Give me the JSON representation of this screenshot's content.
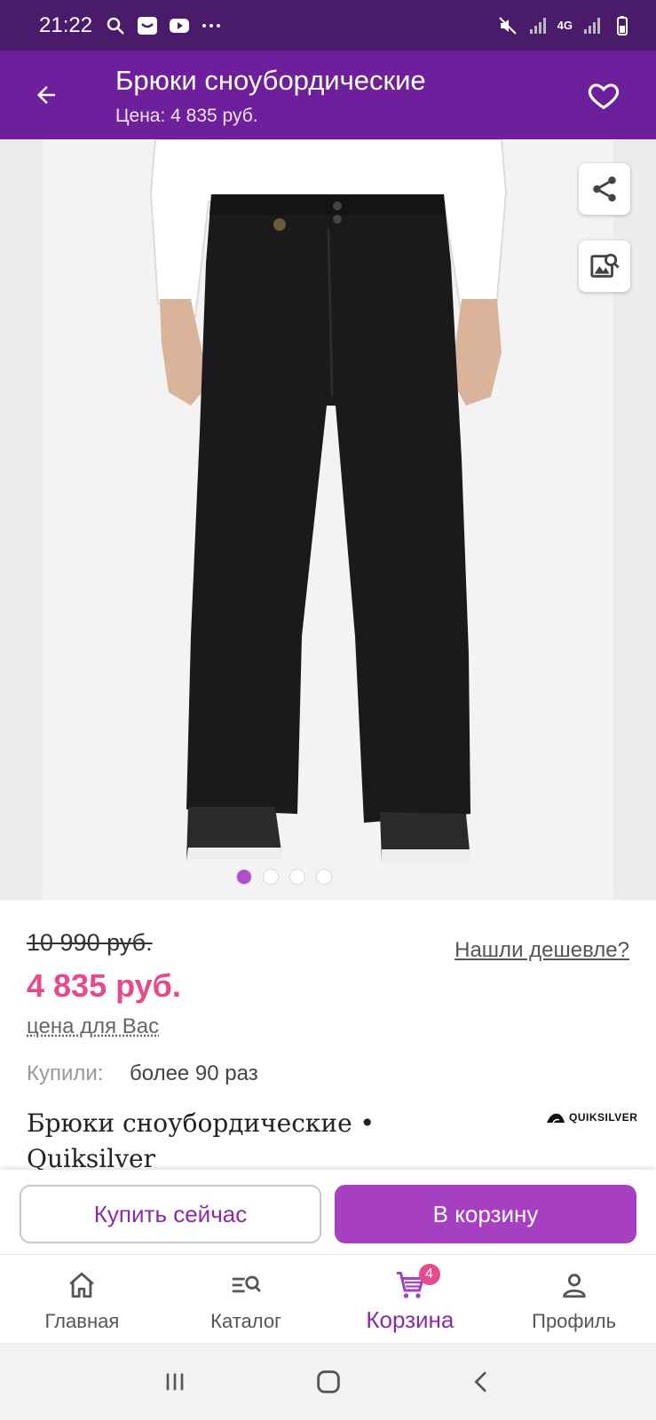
{
  "status_bar": {
    "time": "21:22",
    "icons_left": [
      "search-icon",
      "app-notification-icon",
      "youtube-icon",
      "more-dots-icon"
    ],
    "icons_right": [
      "mute-icon",
      "signal-icon",
      "network-4g-icon",
      "signal-icon",
      "battery-icon"
    ],
    "network_label": "4G"
  },
  "app_bar": {
    "title": "Брюки сноубордические",
    "subtitle": "Цена: 4 835 руб.",
    "background": "#6d1f9c"
  },
  "gallery": {
    "image_count": 4,
    "active_index": 0,
    "buttons": [
      "share-icon",
      "image-search-icon"
    ]
  },
  "product": {
    "old_price": "10 990 руб.",
    "cheaper_link": "Нашли дешевле?",
    "price": "4 835 руб.",
    "price_note": "цена для Вас",
    "bought_label": "Купили:",
    "bought_value": "более 90 раз",
    "name": "Брюки сноубордические • Quiksilver",
    "brand": "QUIKSILVER",
    "price_color": "#e54a8c"
  },
  "actions": {
    "buy_now": "Купить сейчас",
    "to_cart": "В корзину",
    "accent": "#a73fc3"
  },
  "bottom_nav": {
    "items": [
      {
        "label": "Главная",
        "icon": "home-icon"
      },
      {
        "label": "Каталог",
        "icon": "catalog-search-icon"
      },
      {
        "label": "Корзина",
        "icon": "cart-icon",
        "badge": "4",
        "active": true
      },
      {
        "label": "Профиль",
        "icon": "profile-icon"
      }
    ]
  },
  "system_nav": {
    "buttons": [
      "recent-apps-icon",
      "home-button-icon",
      "back-button-icon"
    ]
  }
}
